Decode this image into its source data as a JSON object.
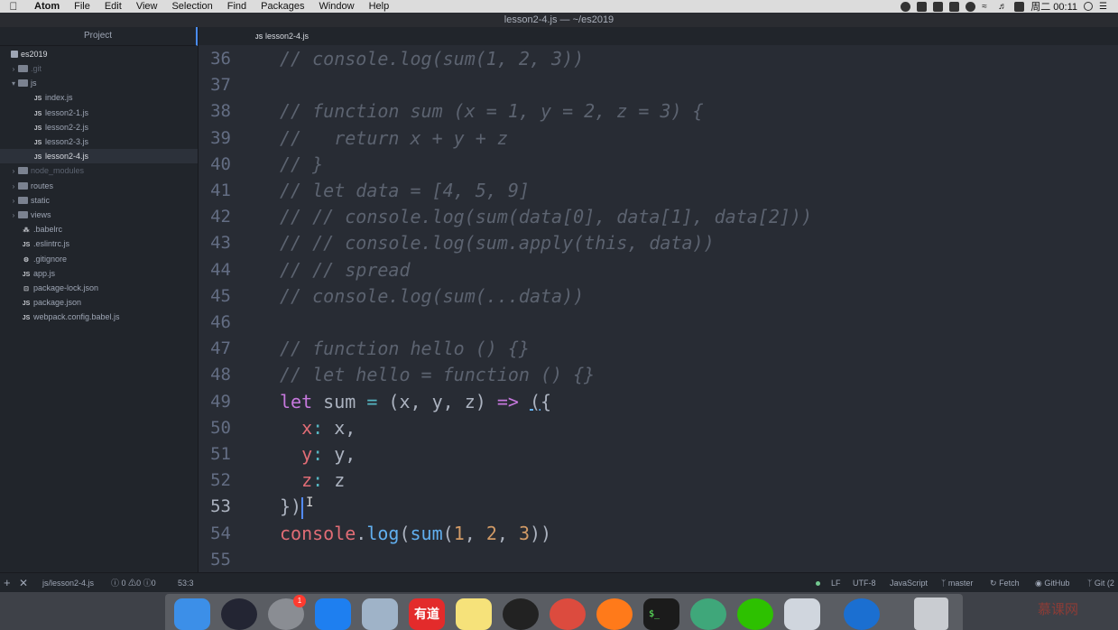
{
  "menubar": {
    "app": "Atom",
    "items": [
      "File",
      "Edit",
      "View",
      "Selection",
      "Find",
      "Packages",
      "Window",
      "Help"
    ],
    "clock": "周二 00:11"
  },
  "window": {
    "title": "lesson2-4.js — ~/es2019"
  },
  "sidebar": {
    "header": "Project",
    "root": "es2019",
    "tree": [
      {
        "label": ".git",
        "type": "folder",
        "expanded": false,
        "indent": 1,
        "dim": true
      },
      {
        "label": "js",
        "type": "folder",
        "expanded": true,
        "indent": 1
      },
      {
        "label": "index.js",
        "type": "js",
        "indent": 2
      },
      {
        "label": "lesson2-1.js",
        "type": "js",
        "indent": 2
      },
      {
        "label": "lesson2-2.js",
        "type": "js",
        "indent": 2
      },
      {
        "label": "lesson2-3.js",
        "type": "js",
        "indent": 2
      },
      {
        "label": "lesson2-4.js",
        "type": "js",
        "indent": 2,
        "selected": true
      },
      {
        "label": "node_modules",
        "type": "folder",
        "expanded": false,
        "indent": 1,
        "dim": true
      },
      {
        "label": "routes",
        "type": "folder",
        "expanded": false,
        "indent": 1
      },
      {
        "label": "static",
        "type": "folder",
        "expanded": false,
        "indent": 1
      },
      {
        "label": "views",
        "type": "folder",
        "expanded": false,
        "indent": 1
      },
      {
        "label": ".babelrc",
        "type": "config",
        "indent": 1
      },
      {
        "label": ".eslintrc.js",
        "type": "js",
        "indent": 1
      },
      {
        "label": ".gitignore",
        "type": "gear",
        "indent": 1
      },
      {
        "label": "app.js",
        "type": "js",
        "indent": 1
      },
      {
        "label": "package-lock.json",
        "type": "lock",
        "indent": 1
      },
      {
        "label": "package.json",
        "type": "json",
        "indent": 1
      },
      {
        "label": "webpack.config.babel.js",
        "type": "js",
        "indent": 1
      }
    ]
  },
  "tabs": [
    {
      "label": "lesson2-4.js",
      "icon": "js-file-icon",
      "active": true
    }
  ],
  "editor": {
    "lines": [
      {
        "n": "36",
        "tokens": [
          [
            "cmt",
            "// console.log(sum(1, 2, 3))"
          ]
        ]
      },
      {
        "n": "37",
        "tokens": []
      },
      {
        "n": "38",
        "tokens": [
          [
            "cmt",
            "// function sum (x = 1, y = 2, z = 3) {"
          ]
        ]
      },
      {
        "n": "39",
        "tokens": [
          [
            "cmt",
            "//   return x + y + z"
          ]
        ]
      },
      {
        "n": "40",
        "tokens": [
          [
            "cmt",
            "// }"
          ]
        ]
      },
      {
        "n": "41",
        "tokens": [
          [
            "cmt",
            "// let data = [4, 5, 9]"
          ]
        ]
      },
      {
        "n": "42",
        "tokens": [
          [
            "cmt",
            "// // console.log(sum(data[0], data[1], data[2]))"
          ]
        ]
      },
      {
        "n": "43",
        "tokens": [
          [
            "cmt",
            "// // console.log(sum.apply(this, data))"
          ]
        ]
      },
      {
        "n": "44",
        "tokens": [
          [
            "cmt",
            "// // spread"
          ]
        ]
      },
      {
        "n": "45",
        "tokens": [
          [
            "cmt",
            "// console.log(sum(...data))"
          ]
        ]
      },
      {
        "n": "46",
        "tokens": []
      },
      {
        "n": "47",
        "tokens": [
          [
            "cmt",
            "// function hello () {}"
          ]
        ]
      },
      {
        "n": "48",
        "tokens": [
          [
            "cmt",
            "// let hello = function () {}"
          ]
        ]
      },
      {
        "n": "49",
        "tokens": [
          [
            "kw",
            "let"
          ],
          [
            "plain",
            " sum "
          ],
          [
            "op",
            "="
          ],
          [
            "plain",
            " (x, y, z) "
          ],
          [
            "kw",
            "=>"
          ],
          [
            "plain",
            " "
          ],
          [
            "ul",
            "("
          ],
          [
            "plain",
            "{"
          ]
        ]
      },
      {
        "n": "50",
        "tokens": [
          [
            "plain",
            "  "
          ],
          [
            "prop",
            "x"
          ],
          [
            "op",
            ":"
          ],
          [
            "plain",
            " x,"
          ]
        ]
      },
      {
        "n": "51",
        "tokens": [
          [
            "plain",
            "  "
          ],
          [
            "prop",
            "y"
          ],
          [
            "op",
            ":"
          ],
          [
            "plain",
            " y,"
          ]
        ]
      },
      {
        "n": "52",
        "tokens": [
          [
            "plain",
            "  "
          ],
          [
            "prop",
            "z"
          ],
          [
            "op",
            ":"
          ],
          [
            "plain",
            " z"
          ]
        ]
      },
      {
        "n": "53",
        "tokens": [
          [
            "plain",
            "})"
          ],
          [
            "cursor",
            ""
          ]
        ]
      },
      {
        "n": "54",
        "tokens": [
          [
            "var",
            "console"
          ],
          [
            "plain",
            "."
          ],
          [
            "fn",
            "log"
          ],
          [
            "plain",
            "("
          ],
          [
            "fn",
            "sum"
          ],
          [
            "plain",
            "("
          ],
          [
            "num",
            "1"
          ],
          [
            "plain",
            ", "
          ],
          [
            "num",
            "2"
          ],
          [
            "plain",
            ", "
          ],
          [
            "num",
            "3"
          ],
          [
            "plain",
            "))"
          ]
        ]
      },
      {
        "n": "55",
        "tokens": []
      }
    ]
  },
  "statusbar": {
    "file_path": "js/lesson2-4.js",
    "errors": "0",
    "warnings": "0",
    "infos": "0",
    "cursor_pos": "53:3",
    "line_ending": "LF",
    "encoding": "UTF-8",
    "grammar": "JavaScript",
    "branch": "master",
    "fetch": "Fetch",
    "github": "GitHub",
    "git": "Git (2"
  },
  "dock": {
    "apps": [
      "finder-icon",
      "siri-icon",
      "system-preferences-icon",
      "app-store-icon",
      "mail-icon",
      "youdao-icon",
      "notes-icon",
      "qq-icon",
      "chrome-icon",
      "firefox-icon",
      "terminal-icon",
      "atom-icon",
      "wechat-icon",
      "preview-icon",
      "browser-icon"
    ],
    "badge": "1",
    "youdao_label": "有道"
  },
  "watermark": "慕课网"
}
